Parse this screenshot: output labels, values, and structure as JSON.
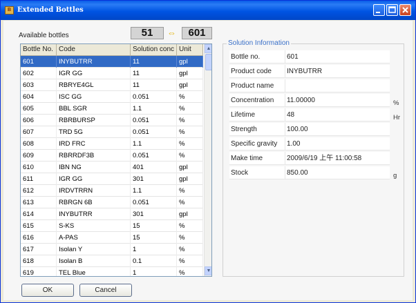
{
  "window": {
    "title": "Extended Bottles",
    "icon": "app-icon"
  },
  "bottles": {
    "available_label": "Available bottles",
    "count_available": "51",
    "swap_icon": "swap-arrows-icon",
    "count_total": "601",
    "columns": [
      "Bottle No.",
      "Code",
      "Solution conc",
      "Unit"
    ],
    "rows": [
      {
        "no": "601",
        "code": "INYBUTRR",
        "conc": "11",
        "unit": "gpl",
        "selected": true
      },
      {
        "no": "602",
        "code": "IGR GG",
        "conc": "11",
        "unit": "gpl"
      },
      {
        "no": "603",
        "code": "RBRYE4GL",
        "conc": "11",
        "unit": "gpl"
      },
      {
        "no": "604",
        "code": "ISC GG",
        "conc": "0.051",
        "unit": "%"
      },
      {
        "no": "605",
        "code": "BBL SGR",
        "conc": "1.1",
        "unit": "%"
      },
      {
        "no": "606",
        "code": "RBRBURSP",
        "conc": "0.051",
        "unit": "%"
      },
      {
        "no": "607",
        "code": "TRD 5G",
        "conc": "0.051",
        "unit": "%"
      },
      {
        "no": "608",
        "code": "IRD FRC",
        "conc": "1.1",
        "unit": "%"
      },
      {
        "no": "609",
        "code": "RBRRDF3B",
        "conc": "0.051",
        "unit": "%"
      },
      {
        "no": "610",
        "code": "IBN NG",
        "conc": "401",
        "unit": "gpl"
      },
      {
        "no": "611",
        "code": "IGR GG",
        "conc": "301",
        "unit": "gpl"
      },
      {
        "no": "612",
        "code": "IRDVTRRN",
        "conc": "1.1",
        "unit": "%"
      },
      {
        "no": "613",
        "code": "RBRGN 6B",
        "conc": "0.051",
        "unit": "%"
      },
      {
        "no": "614",
        "code": "INYBUTRR",
        "conc": "301",
        "unit": "gpl"
      },
      {
        "no": "615",
        "code": "S-KS",
        "conc": "15",
        "unit": "%"
      },
      {
        "no": "616",
        "code": "A-PAS",
        "conc": "15",
        "unit": "%"
      },
      {
        "no": "617",
        "code": "Isolan Y",
        "conc": "1",
        "unit": "%"
      },
      {
        "no": "618",
        "code": "Isolan B",
        "conc": "0.1",
        "unit": "%"
      },
      {
        "no": "619",
        "code": "TEL Blue",
        "conc": "1",
        "unit": "%"
      }
    ]
  },
  "solution_info": {
    "group_title": "Solution Information",
    "fields": [
      {
        "label": "Bottle no.",
        "value": "601",
        "unit": ""
      },
      {
        "label": "Product code",
        "value": "INYBUTRR",
        "unit": ""
      },
      {
        "label": "Product name",
        "value": "",
        "unit": ""
      },
      {
        "label": "Concentration",
        "value": "11.00000",
        "unit": "%"
      },
      {
        "label": "Lifetime",
        "value": "48",
        "unit": "Hr"
      },
      {
        "label": "Strength",
        "value": "100.00",
        "unit": ""
      },
      {
        "label": "Specific gravity",
        "value": "1.00",
        "unit": ""
      },
      {
        "label": "Make time",
        "value": "2009/6/19 上午 11:00:58",
        "unit": ""
      },
      {
        "label": "Stock",
        "value": "850.00",
        "unit": "g"
      }
    ]
  },
  "buttons": {
    "ok": "OK",
    "cancel": "Cancel"
  },
  "colors": {
    "titlebar": "#0054e3",
    "selection": "#316ac5",
    "group_title": "#3a70c8"
  }
}
